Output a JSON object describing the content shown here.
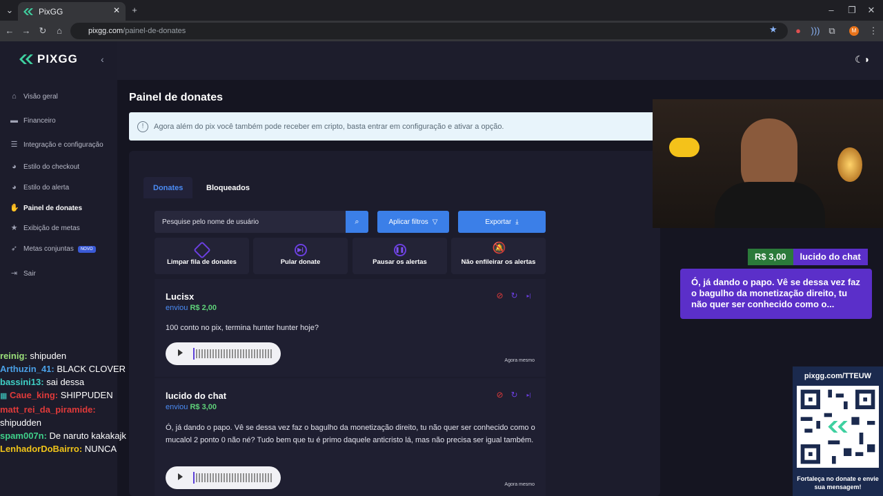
{
  "browser": {
    "tab_title": "PixGG",
    "url_host": "pixgg.com",
    "url_path": "/painel-de-donates"
  },
  "sidebar": {
    "brand": "PIXGG",
    "items": [
      {
        "label": "Visão geral",
        "icon": "home-icon"
      },
      {
        "label": "Financeiro",
        "icon": "wallet-icon"
      },
      {
        "label": "Integração e configuração",
        "icon": "document-icon"
      },
      {
        "label": "Estilo do checkout",
        "icon": "palette-icon"
      },
      {
        "label": "Estilo do alerta",
        "icon": "palette-icon"
      },
      {
        "label": "Painel de donates",
        "icon": "hand-heart-icon"
      },
      {
        "label": "Exibição de metas",
        "icon": "star-icon"
      },
      {
        "label": "Metas conjuntas",
        "icon": "rocket-icon",
        "badge": "NOVO"
      },
      {
        "label": "Sair",
        "icon": "logout-icon"
      }
    ]
  },
  "main": {
    "title": "Painel de donates",
    "info": "Agora além do pix você também pode receber em cripto, basta entrar em configuração e ativar a opção.",
    "tabs": [
      "Donates",
      "Bloqueados"
    ],
    "search_placeholder": "Pesquise pelo nome de usuário",
    "apply_filters": "Aplicar filtros",
    "export": "Exportar",
    "actions": [
      "Limpar fila de donates",
      "Pular donate",
      "Pausar os alertas",
      "Não enfileirar os alertas"
    ],
    "donations": [
      {
        "name": "Lucisx",
        "sent": "enviou",
        "amount": "R$ 2,00",
        "message": "100 conto no pix, termina hunter hunter hoje?",
        "time": "Agora mesmo"
      },
      {
        "name": "lucido do chat",
        "sent": "enviou",
        "amount": "R$ 3,00",
        "message": "Ó, já dando o papo. Vê se dessa vez faz o bagulho da monetização direito, tu não quer ser conhecido como o mucalol 2 ponto 0 não né? Tudo bem que tu é primo daquele anticristo lá, mas não precisa ser igual também.",
        "time": "Agora mesmo"
      }
    ]
  },
  "overlay": {
    "alert_amount": "R$ 3,00",
    "alert_name": "lucido do chat",
    "alert_text": "Ó, já dando o papo. Vê se dessa vez faz o bagulho da monetização direito, tu não quer ser conhecido como o...",
    "chat": [
      {
        "user": "reinig:",
        "text": "shipuden",
        "color": "#9be07a"
      },
      {
        "user": "Arthuzin_41:",
        "text": "BLACK CLOVER",
        "color": "#4aa0e6"
      },
      {
        "user": "bassini13:",
        "text": "sai dessa",
        "color": "#3fd0c6"
      },
      {
        "user": "Caue_king:",
        "text": "SHIPPUDEN",
        "color": "#e03a3a"
      },
      {
        "user": "matt_rei_da_piramide:",
        "text": "shipudden",
        "color": "#e03a3a"
      },
      {
        "user": "spam007n:",
        "text": "De naruto kakakajk",
        "color": "#3fd08a"
      },
      {
        "user": "LenhadorDoBairro:",
        "text": "NUNCA",
        "color": "#f0c419"
      }
    ],
    "qr_url": "pixgg.com/TTEUW",
    "qr_footer": "Fortaleça no donate e envie sua mensagem!"
  }
}
